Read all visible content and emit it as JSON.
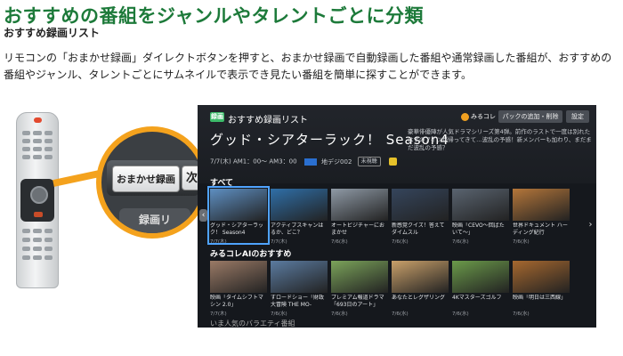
{
  "page": {
    "heading": "おすすめの番組をジャンルやタレントごとに分類",
    "subheading": "おすすめ録画リスト",
    "description": "リモコンの「おまかせ録画」ダイレクトボタンを押すと、おまかせ録画で自動録画した番組や通常録画した番組が、おすすめの番組やジャンル、タレントごとにサムネイルで表示でき見たい番組を簡単に探すことができます。"
  },
  "remote": {
    "zoom_button_label": "おまかせ録画",
    "next_button_label": "次",
    "lower_button_label": "録画リ",
    "accent_color": "#f4a21d"
  },
  "tv": {
    "logo_text": "録画",
    "screen_title": "おすすめ録画リスト",
    "mirukore_badge": "みるコレ",
    "pack_button": "パックの追加・削除",
    "settings_button": "設定",
    "program_title": "グッド・シアターラック！ Season4",
    "program_summary": "豪華俳優陣が人気ドラマシリーズ第4弾。前作のラストで一度は別れたはずのアイツが帰ってきて…波乱の予感！新メンバーも加わり、まだまだ波乱の予感？",
    "meta_date": "7/7(木) AM1：00～ AM3：00",
    "meta_channel": "地デジ002",
    "meta_tag": "未視聴",
    "section_all": "すべて",
    "section_mirukore": "みるコレAIのおすすめ",
    "section_next": "いま人気のバラエティ番組",
    "row1": [
      {
        "caption": "グッド・シアターラック！ Season4",
        "sub": "7/7(木)",
        "thumb": "#5e8fc2",
        "focused": true
      },
      {
        "caption": "アクティブスキャンはるか、どこ？",
        "sub": "7/7(木)",
        "thumb": "#2f6fa8"
      },
      {
        "caption": "オートビジチャーにおまかせ",
        "sub": "7/6(水)",
        "thumb": "#8f9aa6"
      },
      {
        "caption": "新感覚クイズ！答えてダイムスル",
        "sub": "7/6(水)",
        "thumb": "#35455c"
      },
      {
        "caption": "映画「CEVO～回ばたいて～」",
        "sub": "7/6(水)",
        "thumb": "#5a6470"
      },
      {
        "caption": "世界ドキュメント ハーディング紀行",
        "sub": "7/6(水)",
        "thumb": "#b4763a"
      }
    ],
    "row2": [
      {
        "caption": "映画「タイムシフトマシン 2.0」",
        "sub": "7/7(木)",
        "thumb": "#9a7a66"
      },
      {
        "caption": "すロードショー「財政大冒険 THE MO-",
        "sub": "7/6(水)",
        "thumb": "#5b7ba0"
      },
      {
        "caption": "プレミアム報道ドラマ「693日のアート」",
        "sub": "7/6(水)",
        "thumb": "#7ba35a"
      },
      {
        "caption": "あなたとレグザリング",
        "sub": "7/6(水)",
        "thumb": "#c9a06a"
      },
      {
        "caption": "4Kマスターズゴルフ",
        "sub": "7/6(水)",
        "thumb": "#6b9a4a"
      },
      {
        "caption": "映画「明日は三西線」",
        "sub": "7/6(水)",
        "thumb": "#a6682f"
      }
    ]
  }
}
